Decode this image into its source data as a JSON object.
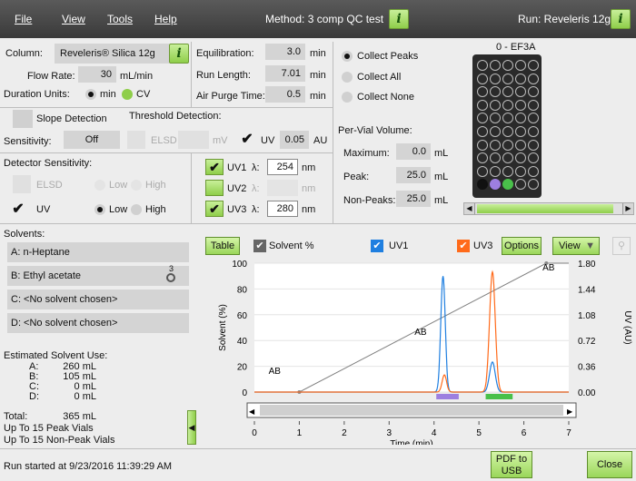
{
  "menu": {
    "file": "File",
    "view": "View",
    "tools": "Tools",
    "help": "Help"
  },
  "method": {
    "label": "Method: 3 comp QC test"
  },
  "run": {
    "label": "Run: Reveleris 12g"
  },
  "info_glyph": "i",
  "params": {
    "column_label": "Column:",
    "column_value": "Reveleris® Silica 12g",
    "flow_label": "Flow Rate:",
    "flow_value": "30",
    "flow_unit": "mL/min",
    "duration_label": "Duration Units:",
    "duration_min": "min",
    "duration_cv": "CV",
    "equil_label": "Equilibration:",
    "equil_value": "3.0",
    "equil_unit": "min",
    "runlen_label": "Run Length:",
    "runlen_value": "7.01",
    "runlen_unit": "min",
    "purge_label": "Air Purge Time:",
    "purge_value": "0.5",
    "purge_unit": "min"
  },
  "collect": {
    "peaks": "Collect Peaks",
    "all": "Collect All",
    "none": "Collect None",
    "selected": "peaks"
  },
  "rack": {
    "title": "0 - EF3A",
    "rows": 10,
    "cols": 5,
    "filled": [
      {
        "index": 45,
        "color": "#111111"
      },
      {
        "index": 46,
        "color": "#9d7fe0"
      },
      {
        "index": 47,
        "color": "#49c04a"
      }
    ]
  },
  "slope": {
    "label": "Slope Detection",
    "threshold_label": "Threshold Detection:",
    "sens_label": "Sensitivity:",
    "sens_value": "Off",
    "elsd": "ELSD",
    "mv": "mV",
    "uv": "UV",
    "uv_value": "0.05",
    "au": "AU"
  },
  "detector": {
    "label": "Detector Sensitivity:",
    "elsd": "ELSD",
    "low": "Low",
    "high": "High",
    "uv": "UV"
  },
  "uvch": {
    "lambda": "λ:",
    "nm": "nm",
    "uv1": "UV1",
    "uv1_value": "254",
    "uv2": "UV2",
    "uv3": "UV3",
    "uv3_value": "280"
  },
  "vial": {
    "label": "Per-Vial Volume:",
    "max_label": "Maximum:",
    "max_value": "0.0",
    "peak_label": "Peak:",
    "peak_value": "25.0",
    "nonpeak_label": "Non-Peaks:",
    "nonpeak_value": "25.0",
    "unit": "mL"
  },
  "solvents": {
    "label": "Solvents:",
    "a": "A: n-Heptane",
    "b": "B: Ethyl acetate",
    "b_badge": "3",
    "c": "C: <No solvent chosen>",
    "d": "D: <No solvent chosen>"
  },
  "usage": {
    "title": "Estimated Solvent Use:",
    "rows": [
      {
        "k": "A:",
        "v": "260 mL"
      },
      {
        "k": "B:",
        "v": "105 mL"
      },
      {
        "k": "C:",
        "v": "0 mL"
      },
      {
        "k": "D:",
        "v": "0 mL"
      }
    ],
    "total_k": "Total:",
    "total_v": "365 mL",
    "peak_vials": "Up To 15 Peak Vials",
    "nonpeak_vials": "Up To 15 Non-Peak Vials"
  },
  "chart_toolbar": {
    "table": "Table",
    "solvent_pct": "Solvent %",
    "uv1": "UV1",
    "uv3": "UV3",
    "options": "Options",
    "view": "View"
  },
  "status": {
    "text": "Run started at 9/23/2016 11:39:29 AM",
    "pdf": "PDF to\nUSB",
    "close": "Close"
  },
  "chart_data": {
    "type": "line",
    "xlabel": "Time (min)",
    "ylabel_left": "Solvent (%)",
    "ylabel_right": "UV (AU)",
    "xlim": [
      0,
      7
    ],
    "ylim_left": [
      0,
      100
    ],
    "ylim_right": [
      0,
      1.8
    ],
    "x_ticks": [
      0,
      1,
      2,
      3,
      4,
      5,
      6,
      7
    ],
    "y_left_ticks": [
      0,
      20,
      40,
      60,
      80,
      100
    ],
    "y_right_ticks": [
      "0.00",
      "0.36",
      "0.72",
      "1.08",
      "1.44",
      "1.80"
    ],
    "segment_labels": [
      {
        "text": "AB",
        "x": 0.45,
        "y": 10
      },
      {
        "text": "AB",
        "x": 3.7,
        "y": 40
      },
      {
        "text": "AB",
        "x": 6.55,
        "y": 90
      }
    ],
    "solvent": {
      "name": "Solvent %",
      "color": "#808080",
      "points": [
        [
          0,
          0
        ],
        [
          1,
          0
        ],
        [
          6.5,
          100
        ],
        [
          7,
          100
        ]
      ]
    },
    "series": [
      {
        "name": "UV1",
        "color": "#1f7fe0",
        "peaks": [
          {
            "x": 4.2,
            "h": 1.62,
            "w": 0.07
          },
          {
            "x": 5.3,
            "h": 0.42,
            "w": 0.09
          }
        ]
      },
      {
        "name": "UV3",
        "color": "#ff6a1a",
        "peaks": [
          {
            "x": 4.23,
            "h": 0.24,
            "w": 0.07
          },
          {
            "x": 5.3,
            "h": 1.68,
            "w": 0.09
          }
        ]
      }
    ],
    "fractions": [
      {
        "start": 4.05,
        "end": 4.55,
        "color": "#9d7fe0"
      },
      {
        "start": 5.15,
        "end": 5.75,
        "color": "#49c04a"
      }
    ]
  }
}
